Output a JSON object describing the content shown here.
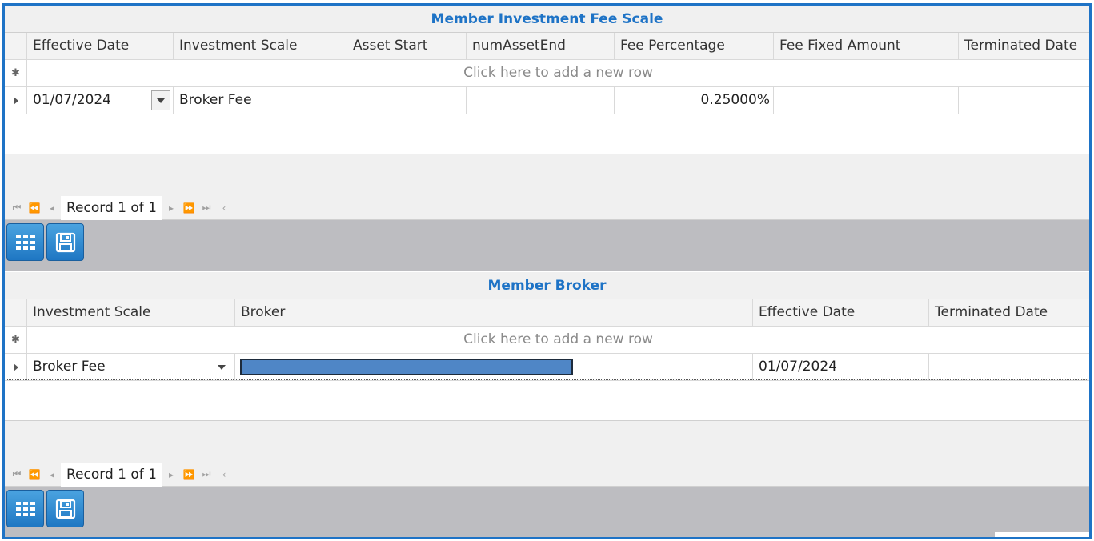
{
  "fee_scale": {
    "title": "Member Investment Fee Scale",
    "columns": [
      "Effective Date",
      "Investment Scale",
      "Asset Start",
      "numAssetEnd",
      "Fee Percentage",
      "Fee Fixed Amount",
      "Terminated Date"
    ],
    "new_row_text": "Click here to add a new row",
    "rows": [
      {
        "effective_date": "01/07/2024",
        "investment_scale": "Broker Fee",
        "asset_start": "",
        "num_asset_end": "",
        "fee_percentage": "0.25000%",
        "fee_fixed_amount": "",
        "terminated_date": ""
      }
    ],
    "pager": {
      "record_text": "Record 1 of 1"
    }
  },
  "member_broker": {
    "title": "Member Broker",
    "columns": [
      "Investment Scale",
      "Broker",
      "Effective Date",
      "Terminated Date"
    ],
    "new_row_text": "Click here to add a new row",
    "rows": [
      {
        "investment_scale": "Broker Fee",
        "broker": "",
        "effective_date": "01/07/2024",
        "terminated_date": ""
      }
    ],
    "pager": {
      "record_text": "Record 1 of 1"
    }
  },
  "icons": {
    "new_row_marker": "asterisk-icon",
    "row_indicator": "row-pointer-icon",
    "grid_button": "grid-icon",
    "save_button": "floppy-disk-icon"
  },
  "colors": {
    "accent": "#1e73c6",
    "toolbar_bg": "#bdbdc1",
    "masked_field": "#4f86c6"
  }
}
